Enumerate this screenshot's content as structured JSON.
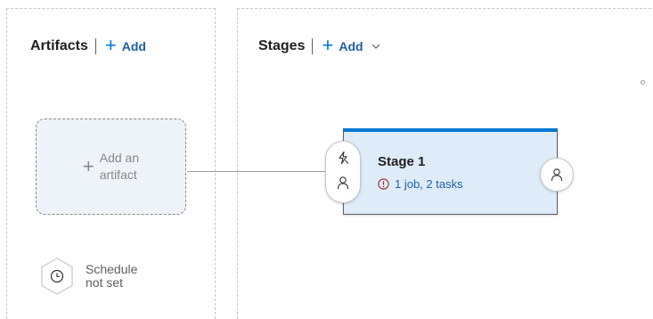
{
  "artifacts": {
    "title": "Artifacts",
    "add_label": "Add",
    "add_artifact_line1": "Add an",
    "add_artifact_line2": "artifact",
    "schedule_line1": "Schedule",
    "schedule_line2": "not set"
  },
  "stages": {
    "title": "Stages",
    "add_label": "Add",
    "stage": {
      "name": "Stage 1",
      "status": "1 job, 2 tasks"
    }
  },
  "icons": {
    "add": "plus-icon",
    "dropdown": "chevron-down-icon",
    "trigger": "lightning-icon",
    "approver": "person-icon",
    "warning": "error-circle-icon",
    "schedule": "clock-icon"
  },
  "colors": {
    "accent": "#0078d4",
    "link": "#1f5fa8",
    "stage_background": "#deecf9",
    "warning": "#a4262c"
  }
}
